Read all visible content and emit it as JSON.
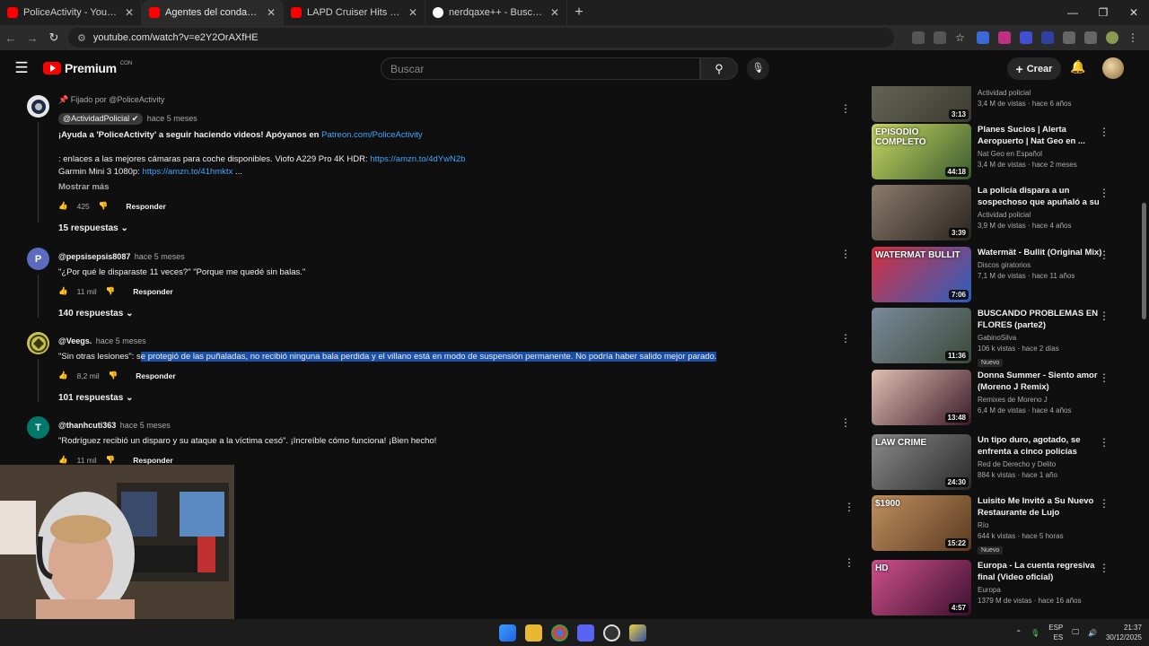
{
  "browser": {
    "tabs": [
      {
        "title": "PoliceActivity - YouTube",
        "type": "youtube"
      },
      {
        "title": "Agentes del condado de Los Ár",
        "type": "youtube"
      },
      {
        "title": "LAPD Cruiser Hits Civilian Car D",
        "type": "youtube"
      },
      {
        "title": "nerdqaxe++ - Buscar con Goog",
        "type": "google"
      }
    ],
    "url": "youtube.com/watch?v=e2Y2OrAXfHE"
  },
  "header": {
    "brand": "Premium",
    "brand_suffix": "CON",
    "search_placeholder": "Buscar",
    "create_label": "Crear"
  },
  "comments": [
    {
      "pinned": "Fijado por @PoliceActivity",
      "handle": "@ActividadPolicial",
      "time": "hace 5 meses",
      "line1_prefix": "¡Ayuda a 'PoliceActivity' a seguir haciendo videos! Apóyanos en",
      "line1_link": "Patreon.com/PoliceActivity",
      "line2_prefix": ": enlaces a las mejores cámaras para coche disponibles. Viofo A229 Pro 4K HDR:",
      "line2_link": "https://amzn.to/4dYwN2b",
      "line3_prefix": "Garmin Mini 3 1080p:",
      "line3_link": "https://amzn.to/41hmktx",
      "line3_suffix": "...",
      "more": "Mostrar más",
      "likes": "425",
      "reply": "Responder",
      "replies": "15 respuestas"
    },
    {
      "avatar_letter": "P",
      "handle": "@pepsisepsis8087",
      "time": "hace 5 meses",
      "text": "\"¿Por qué le disparaste 11 veces?\" \"Porque me quedé sin balas.\"",
      "likes": "11 mil",
      "reply": "Responder",
      "replies": "140 respuestas"
    },
    {
      "handle": "@Veegs.",
      "time": "hace 5 meses",
      "text_prefix": "\"Sin otras lesiones\": s",
      "text_selected": "e protegió de las puñaladas, no recibió ninguna bala perdida y el villano está en modo de suspensión permanente. No podría haber salido mejor parado.",
      "likes": "8,2 mil",
      "reply": "Responder",
      "replies": "101 respuestas"
    },
    {
      "avatar_letter": "T",
      "handle": "@thanhcuti363",
      "time": "hace 5 meses",
      "text": "\"Rodríguez recibió un disparo y su ataque a la víctima cesó\". ¡Increíble cómo funciona! ¡Bien hecho!",
      "likes": "11 mil",
      "reply": "Responder"
    }
  ],
  "sidebar": [
    {
      "title": "",
      "channel": "Actividad policial",
      "stats": "3,4 M de vistas · hace 6 años",
      "duration": "3:13",
      "badge": "",
      "thumb": [
        "#6a6a5a",
        "#3a3a30"
      ]
    },
    {
      "title": "Planes Sucios | Alerta Aeropuerto | Nat Geo en ...",
      "channel": "Nat Geo en Español",
      "stats": "3,4 M de vistas · hace 2 meses",
      "duration": "44:18",
      "badge": "",
      "thumb_text": "EPISODIO COMPLETO",
      "thumb": [
        "#c8d860",
        "#3a5a30"
      ]
    },
    {
      "title": "La policía dispara a un sospechoso que apuñaló a su ...",
      "channel": "Actividad policial",
      "stats": "3,9 M de vistas · hace 4 años",
      "duration": "3:39",
      "badge": "",
      "thumb": [
        "#8a7a6a",
        "#2a2420"
      ]
    },
    {
      "title": "Watermät - Bullit (Original Mix)",
      "channel": "Discos giratorios",
      "stats": "7,1 M de vistas · hace 11 años",
      "duration": "7:06",
      "badge": "",
      "thumb_text": "WATERMAT BULLIT",
      "thumb": [
        "#d63040",
        "#2a60c0"
      ]
    },
    {
      "title": "BUSCANDO PROBLEMAS EN FLORES (parte2)",
      "channel": "GabinoSilva",
      "stats": "106 k vistas · hace 2 días",
      "duration": "11:36",
      "badge": "Nuevo",
      "thumb": [
        "#7a8a9a",
        "#3a4a3a"
      ]
    },
    {
      "title": "Donna Summer - Siento amor (Moreno J Remix)",
      "channel": "Remixes de Moreno J",
      "stats": "6,4 M de vistas · hace 4 años",
      "duration": "13:48",
      "badge": "",
      "thumb": [
        "#e0c0b0",
        "#3a1a2a"
      ]
    },
    {
      "title": "Un tipo duro, agotado, se enfrenta a cinco policías",
      "channel": "Red de Derecho y Delito",
      "stats": "884 k vistas · hace 1 año",
      "duration": "24:30",
      "badge": "",
      "thumb_text": "LAW CRIME",
      "thumb": [
        "#8a8a8a",
        "#2a2a2a"
      ]
    },
    {
      "title": "Luisito Me Invitó a Su Nuevo Restaurante de Lujo",
      "channel": "Río",
      "stats": "644 k vistas · hace 5 horas",
      "duration": "15:22",
      "badge": "Nuevo",
      "thumb_text": "$1900",
      "thumb": [
        "#c09060",
        "#5a3a20"
      ]
    },
    {
      "title": "Europa - La cuenta regresiva final (Video oficial)",
      "channel": "Europa",
      "stats": "1379 M de vistas · hace 16 años",
      "duration": "4:57",
      "badge": "",
      "thumb_text": "HD",
      "thumb": [
        "#d0508a",
        "#3a1030"
      ]
    }
  ],
  "taskbar": {
    "lang1": "ESP",
    "lang2": "ES",
    "time": "21:37",
    "date": "30/12/2025"
  },
  "colors": {
    "link": "#3ea6ff",
    "selection": "#1a4fa8",
    "brand_red": "#ff0000"
  }
}
